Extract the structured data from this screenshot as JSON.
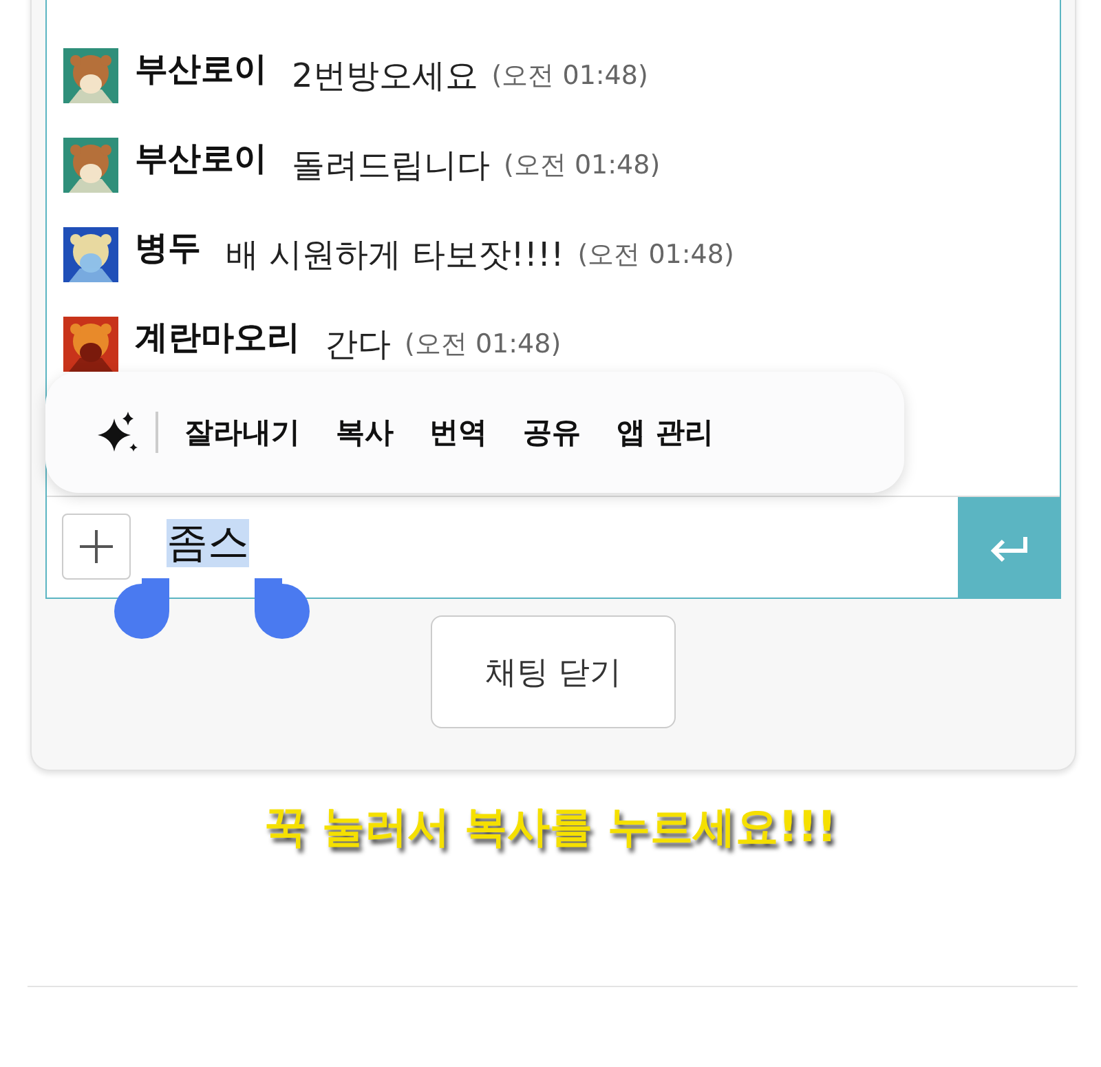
{
  "messages": [
    {
      "name": "부산로이",
      "text": "2번방오세요",
      "time": "(오전 01:48)"
    },
    {
      "name": "부산로이",
      "text": "돌려드립니다",
      "time": "(오전 01:48)"
    },
    {
      "name": "병두",
      "text": "배 시원하게 타보잣!!!!",
      "time": "(오전 01:48)"
    },
    {
      "name": "계란마오리",
      "text": "간다",
      "time": "(오전 01:48)"
    }
  ],
  "context_menu": {
    "items": [
      "잘라내기",
      "복사",
      "번역",
      "공유",
      "앱 관리"
    ]
  },
  "input": {
    "value": "좀스",
    "selected": true
  },
  "close_button": "채팅 닫기",
  "caption": "꾹 눌러서 복사를 누르세요!!!"
}
